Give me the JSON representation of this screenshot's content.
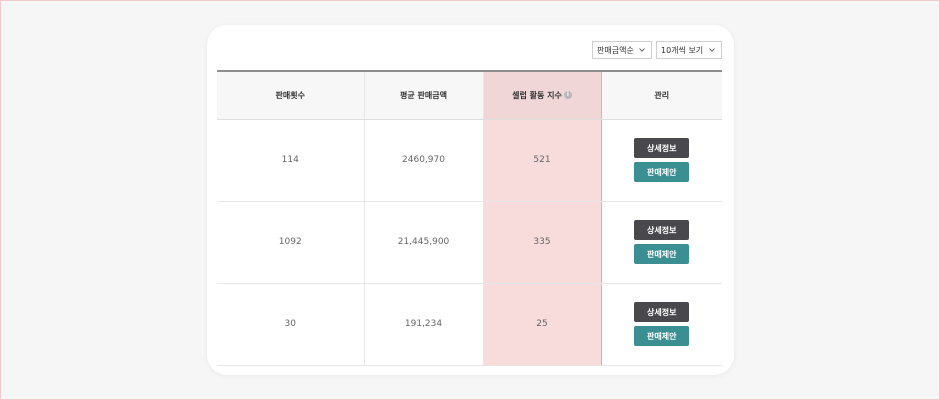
{
  "toolbar": {
    "sort_select": "판매금액순",
    "count_select": "10개씩 보기"
  },
  "table": {
    "headers": [
      "판매횟수",
      "평균 판매금액",
      "셀럽 활동 지수",
      "관리"
    ],
    "info_icon": "i",
    "rows": [
      {
        "sales_count": "114",
        "avg_amount": "2460,970",
        "activity_index": "521"
      },
      {
        "sales_count": "1092",
        "avg_amount": "21,445,900",
        "activity_index": "335"
      },
      {
        "sales_count": "30",
        "avg_amount": "191,234",
        "activity_index": "25"
      }
    ],
    "detail_label": "상세정보",
    "propose_label": "판매제안"
  },
  "colors": {
    "highlight_column": "#f8dcdc",
    "highlight_border": "#e9a8ae",
    "detail_button": "#48484d",
    "propose_button": "#3a8f92"
  }
}
